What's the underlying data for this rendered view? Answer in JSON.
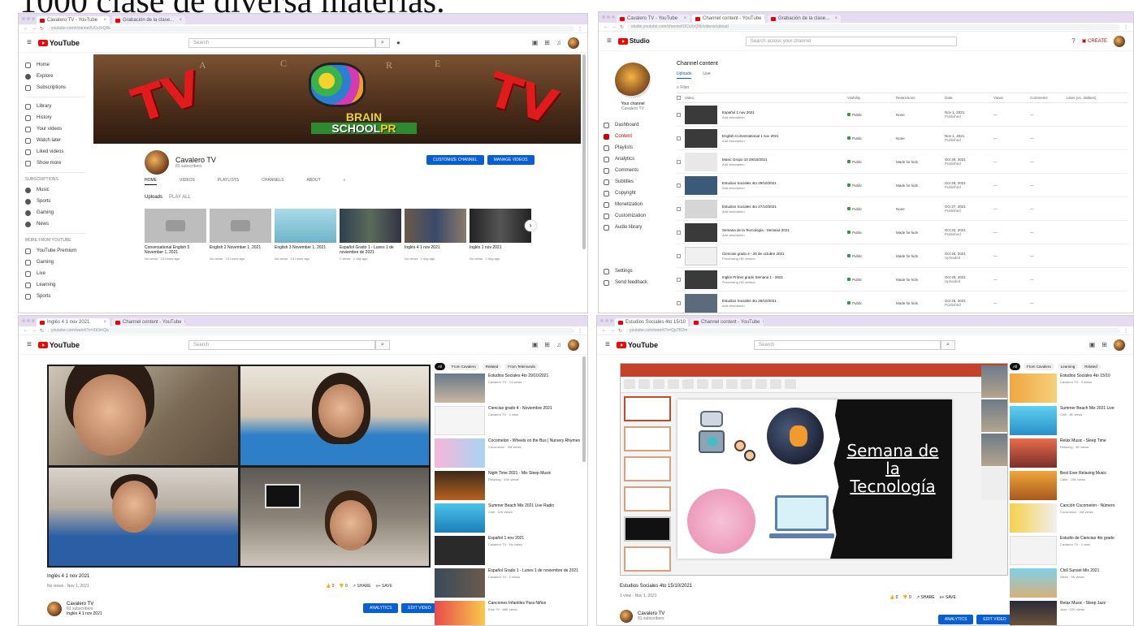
{
  "slide": {
    "title": "1000 clase de diversa materias."
  },
  "colors": {
    "youtube_red": "#ff0000",
    "link_blue": "#065fd4",
    "tab_bar": "#e5dcf2",
    "ppt_red": "#c4412a"
  },
  "w1": {
    "tabs": [
      "Cavalero TV - YouTube",
      "Grabación de la clase..."
    ],
    "url": "youtube.com/channel/UCxXrQ6k",
    "logo": "YouTube",
    "search_placeholder": "Search",
    "sidebar_main": [
      "Home",
      "Explore",
      "Subscriptions",
      "Library",
      "History",
      "Your videos",
      "Watch later",
      "Liked videos",
      "Show more"
    ],
    "sidebar_subs_title": "SUBSCRIPTIONS",
    "sidebar_subs": [
      "Music",
      "Sports",
      "Gaming",
      "News"
    ],
    "sidebar_more_title": "MORE FROM YOUTUBE",
    "sidebar_more": [
      "YouTube Premium",
      "Gaming",
      "Live",
      "Learning",
      "Sports"
    ],
    "banner": {
      "tv_left": "TV",
      "tv_right": "TV",
      "brand_line1": "BRAIN",
      "brand_line2": "SCHOOL",
      "brand_suffix": "PR"
    },
    "channel": {
      "name": "Cavalero TV",
      "subs": "81 subscribers",
      "btn_customize": "CUSTOMIZE CHANNEL",
      "btn_manage": "MANAGE VIDEOS"
    },
    "channel_tabs": [
      "HOME",
      "VIDEOS",
      "PLAYLISTS",
      "CHANNELS",
      "ABOUT"
    ],
    "uploads": {
      "label": "Uploads",
      "play_all": "PLAY ALL"
    },
    "videos": [
      {
        "title": "Conversational English 5 November 1, 2021",
        "meta": "No views · 13 hours ago"
      },
      {
        "title": "English 2 November 1, 2021",
        "meta": "No views · 13 hours ago"
      },
      {
        "title": "English 3 November 1, 2021",
        "meta": "No views · 13 hours ago"
      },
      {
        "title": "Español Grado 1 - Lunes 1 de noviembre de 2021",
        "meta": "2 views · 1 day ago"
      },
      {
        "title": "Inglés 4 1 nov 2021",
        "meta": "No views · 1 day ago"
      },
      {
        "title": "Inglés 1 nov 2021",
        "meta": "No views · 1 day ago"
      }
    ]
  },
  "w2": {
    "tabs": [
      "Cavalero TV - YouTube",
      "Channel content - YouTube",
      "Grabación de la clase..."
    ],
    "url": "studio.youtube.com/channel/UCxXrQ6k/videos/upload",
    "logo": "Studio",
    "search_placeholder": "Search across your channel",
    "create_label": "CREATE",
    "channel_label": "Your channel",
    "channel_name": "Cavalero TV",
    "nav": [
      "Dashboard",
      "Content",
      "Playlists",
      "Analytics",
      "Comments",
      "Subtitles",
      "Copyright",
      "Monetization",
      "Customization",
      "Audio library",
      "Settings",
      "Send feedback"
    ],
    "page_title": "Channel content",
    "tabs_content": [
      "Uploads",
      "Live"
    ],
    "filter": "Filter",
    "columns": [
      "Video",
      "Visibility",
      "Restrictions",
      "Date",
      "Views",
      "Comments",
      "Likes (vs. dislikes)"
    ],
    "rows": [
      {
        "title": "Español 1 nov 2021",
        "desc": "Add description",
        "vis": "Public",
        "restr": "None",
        "date": "Nov 1, 2021",
        "sub": "Published"
      },
      {
        "title": "English Conversational 1 nov 2021",
        "desc": "Add description",
        "vis": "Public",
        "restr": "None",
        "date": "Nov 1, 2021",
        "sub": "Published"
      },
      {
        "title": "Music Grupo 10 29/10/2021",
        "desc": "Add description",
        "vis": "Public",
        "restr": "Made for kids",
        "date": "Oct 29, 2021",
        "sub": "Published"
      },
      {
        "title": "Estudios Sociales 4to 29/10/2021",
        "desc": "Add description",
        "vis": "Public",
        "restr": "Made for kids",
        "date": "Oct 29, 2021",
        "sub": "Published"
      },
      {
        "title": "Estudios Sociales 4to 27/10/2021",
        "desc": "Add description",
        "vis": "Public",
        "restr": "None",
        "date": "Oct 27, 2021",
        "sub": "Published"
      },
      {
        "title": "Semana de la Tecnología - Semana 2021",
        "desc": "Add description",
        "vis": "Public",
        "restr": "Made for kids",
        "date": "Oct 22, 2021",
        "sub": "Published"
      },
      {
        "title": "Ciencias grado 4 - 26 de octubre 2021",
        "desc": "Processing HD version",
        "vis": "Public",
        "restr": "Made for kids",
        "date": "Oct 26, 2021",
        "sub": "Uploaded"
      },
      {
        "title": "Inglés Primer grado Semana 1 - 2021",
        "desc": "Processing HD version",
        "vis": "Public",
        "restr": "Made for kids",
        "date": "Oct 25, 2021",
        "sub": "Uploaded"
      },
      {
        "title": "Estudios Sociales 4to 25/10/2021",
        "desc": "Add description",
        "vis": "Public",
        "restr": "Made for kids",
        "date": "Oct 25, 2021",
        "sub": "Published"
      }
    ]
  },
  "w3": {
    "tabs": [
      "Inglés 4 1 nov 2021",
      "Channel content - YouTube"
    ],
    "url": "youtube.com/watch?v=Xk3mQa",
    "logo": "YouTube",
    "search_placeholder": "Search",
    "video_title": "Inglés 4 1 nov 2021",
    "video_meta": "No views · Nov 1, 2021",
    "actions": [
      "0",
      "0",
      "SHARE",
      "SAVE"
    ],
    "channel_name": "Cavalero TV",
    "channel_subs": "81 subscribers",
    "description": "Inglés 4 1 nov 2021",
    "btn_analytics": "ANALYTICS",
    "btn_edit": "EDIT VIDEO",
    "chips": [
      "All",
      "From Cavalero",
      "Related",
      "From Telemundo"
    ],
    "recs": [
      {
        "title": "Estudios Sociales 4to 29/10/2021",
        "meta": "Cavalero TV · 13 views"
      },
      {
        "title": "Ciencias grado 4 - Noviembre 2021",
        "meta": "Cavalero TV · 1 view"
      },
      {
        "title": "Cocomelon - Wheels on the Bus | Nursery Rhymes",
        "meta": "Cocomelon · 2M views"
      },
      {
        "title": "Night Time 2021 - Mix Sleep Music",
        "meta": "Relaxing · 45K views"
      },
      {
        "title": "Summer Beach Mix 2021 Live Radio",
        "meta": "Chill · 12K views"
      },
      {
        "title": "Español 1 nov 2021",
        "meta": "Cavalero TV · No views"
      },
      {
        "title": "Español Grado 1 - Lunes 1 de noviembre de 2021",
        "meta": "Cavalero TV · 2 views"
      },
      {
        "title": "Canciones Infantiles Para Niños",
        "meta": "Kids TV · 88K views"
      }
    ]
  },
  "w4": {
    "tabs": [
      "Estudios Sociales 4to 15/10",
      "Channel content - YouTube"
    ],
    "url": "youtube.com/watch?v=Qp7R2m",
    "logo": "YouTube",
    "search_placeholder": "Search",
    "slide_text": [
      "Semana de",
      "la",
      "Tecnología"
    ],
    "video_title": "Estudios Sociales 4to 15/10/2021",
    "video_meta": "1 view · Nov 1, 2021",
    "actions": [
      "0",
      "0",
      "SHARE",
      "SAVE"
    ],
    "channel_name": "Cavalero TV",
    "channel_subs": "81 subscribers",
    "btn_analytics": "ANALYTICS",
    "btn_edit": "EDIT VIDEO",
    "chips": [
      "All",
      "From Cavalero",
      "Learning",
      "Related"
    ],
    "recs": [
      {
        "title": "Estudios Sociales 4to 15/10",
        "meta": "Cavalero TV · 3 views"
      },
      {
        "title": "Summer Beach Mix 2021 Live",
        "meta": "Chill · 8K views"
      },
      {
        "title": "Relax Music - Sleep Time",
        "meta": "Relaxing · 3K views"
      },
      {
        "title": "Best Ever Relaxing Music",
        "meta": "Calm · 19K views"
      },
      {
        "title": "Canción Cocomelon - Número",
        "meta": "Cocomelon · 2M views"
      },
      {
        "title": "Estudio de Ciencias 4to grado",
        "meta": "Cavalero TV · 1 view"
      },
      {
        "title": "Chill Sunset Mix 2021",
        "meta": "Vibes · 5K views"
      },
      {
        "title": "Relax Music - Sleep Jazz",
        "meta": "Jazz · 22K views"
      }
    ]
  }
}
